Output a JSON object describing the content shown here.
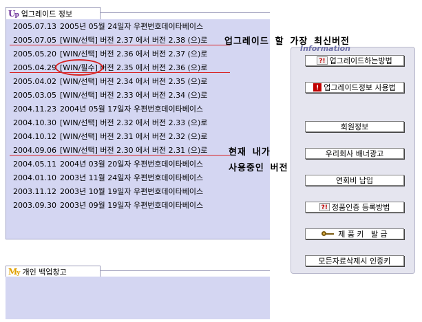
{
  "update_section": {
    "tab_icon_big": "U",
    "tab_icon_small": "p",
    "title": "업그레이드 정보",
    "rows": [
      {
        "date": "2005.07.13",
        "text": "2005년 05월 24일자 우편번호데이타베이스"
      },
      {
        "date": "2005.07.05",
        "text": "[WIN/선택] 버전 2.37 에서 버전 2.38 (으)로"
      },
      {
        "date": "2005.05.20",
        "text": "[WIN/선택] 버전 2.36 에서 버전 2.37 (으)로"
      },
      {
        "date": "2005.04.29",
        "text": "[WIN/필수] 버전 2.35 에서 버전 2.36 (으)로"
      },
      {
        "date": "2005.04.02",
        "text": "[WIN/선택] 버전 2.34 에서 버전 2.35 (으)로"
      },
      {
        "date": "2005.03.05",
        "text": "[WIN/선택] 버전 2.33 에서 버전 2.34 (으)로"
      },
      {
        "date": "2004.11.23",
        "text": "2004년 05월 17일자 우편번호데이타베이스"
      },
      {
        "date": "2004.10.30",
        "text": "[WIN/선택] 버전 2.32 에서 버전 2.33 (으)로"
      },
      {
        "date": "2004.10.12",
        "text": "[WIN/선택] 버전 2.31 에서 버전 2.32 (으)로"
      },
      {
        "date": "2004.09.06",
        "text": "[WIN/선택] 버전 2.30 에서 버전 2.31 (으)로"
      },
      {
        "date": "2004.05.11",
        "text": "2004년 03월 20일자 우편번호데이타베이스"
      },
      {
        "date": "2004.01.10",
        "text": "2003년 11월 24일자 우편번호데이타베이스"
      },
      {
        "date": "2003.11.12",
        "text": "2003년 10월 19일자 우편번호데이타베이스"
      },
      {
        "date": "2003.09.30",
        "text": "2003년 09월 19일자 우편번호데이타베이스"
      }
    ]
  },
  "annotations": {
    "latest": "업그레이드 할 가장 최신버전",
    "current_line1": "현재 내가",
    "current_line2": "사용중인 버전"
  },
  "backup_section": {
    "tab_icon_big": "M",
    "tab_icon_small": "y",
    "title": "개인 백업창고"
  },
  "info_panel": {
    "title": "Information",
    "buttons": [
      {
        "icon": "?!",
        "label": "업그레이드하는방법"
      },
      {
        "icon": "!",
        "label": "업그레이드정보 사용법"
      },
      {
        "icon": "",
        "label": "회원정보"
      },
      {
        "icon": "",
        "label": "우리회사 배너광고"
      },
      {
        "icon": "",
        "label": "연회비 납입"
      },
      {
        "icon": "?!",
        "label": "정품인증 등록방법"
      },
      {
        "icon": "key",
        "label": "제 품 키   발 급"
      },
      {
        "icon": "",
        "label": "모든자료삭제시 인증키"
      }
    ]
  },
  "colors": {
    "panel_bg": "#d4d6f2",
    "highlight_red": "#d82020",
    "info_title": "#6e70a8",
    "up_icon": "#6b2f99",
    "my_icon": "#e0a000"
  }
}
